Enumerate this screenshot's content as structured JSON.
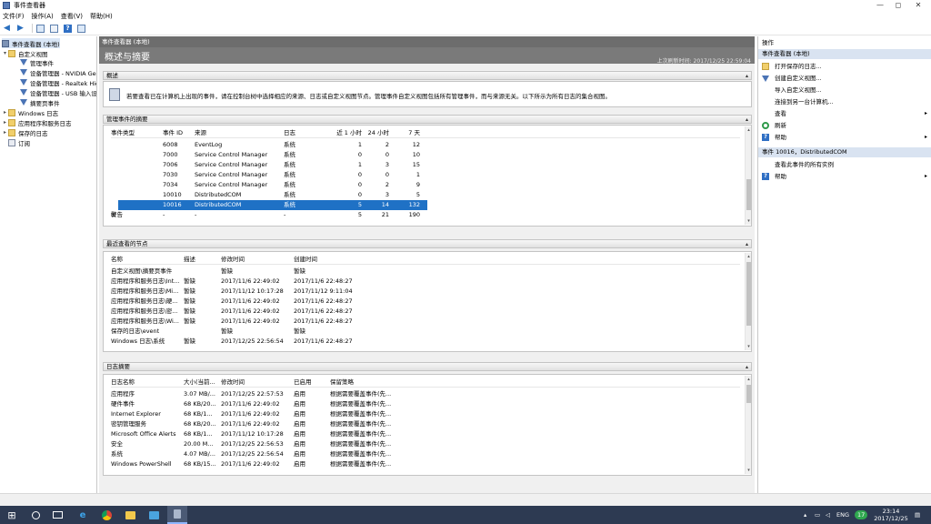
{
  "window": {
    "title": "事件查看器",
    "controls": {
      "minimize": "—",
      "maximize": "◻",
      "close": "✕"
    }
  },
  "menu": [
    "文件(F)",
    "操作(A)",
    "查看(V)",
    "帮助(H)"
  ],
  "tree": {
    "root": "事件查看器 (本地)",
    "items": [
      {
        "label": "自定义视图",
        "level": 1,
        "icon": "folder-icon",
        "expanded": true
      },
      {
        "label": "管理事件",
        "level": 2,
        "icon": "filter-icon"
      },
      {
        "label": "设备管理器 - NVIDIA GeForce",
        "level": 2,
        "icon": "filter-icon"
      },
      {
        "label": "设备管理器 - Realtek High",
        "level": 2,
        "icon": "filter-icon"
      },
      {
        "label": "设备管理器 - USB 输入设备",
        "level": 2,
        "icon": "filter-icon"
      },
      {
        "label": "摘要页事件",
        "level": 2,
        "icon": "filter-icon"
      },
      {
        "label": "Windows 日志",
        "level": 1,
        "icon": "folder-icon"
      },
      {
        "label": "应用程序和服务日志",
        "level": 1,
        "icon": "folder-icon"
      },
      {
        "label": "保存的日志",
        "level": 1,
        "icon": "folder-icon"
      },
      {
        "label": "订阅",
        "level": 1,
        "icon": "log-icon"
      }
    ]
  },
  "center": {
    "header": "事件查看器 (本地)",
    "title": "概述与摘要",
    "last_refresh": "上次刷新时间: 2017/12/25 22:59:04",
    "overview": {
      "label": "概述",
      "text": "若要查看已在计算机上出现的事件，请在控制台树中选择相应的来源、日志或自定义视图节点。管理事件自定义视图包括所有管理事件，而与来源无关。以下所示为所有日志的集合视图。"
    },
    "managed_events": {
      "label": "管理事件的摘要",
      "columns": [
        "事件类型",
        "事件 ID",
        "来源",
        "日志",
        "近 1 小时",
        "24 小时",
        "7 天"
      ],
      "rows": [
        [
          "",
          "6008",
          "EventLog",
          "系统",
          "1",
          "2",
          "12"
        ],
        [
          "",
          "7000",
          "Service Control Manager",
          "系统",
          "0",
          "0",
          "10"
        ],
        [
          "",
          "7006",
          "Service Control Manager",
          "系统",
          "1",
          "3",
          "15"
        ],
        [
          "",
          "7030",
          "Service Control Manager",
          "系统",
          "0",
          "0",
          "1"
        ],
        [
          "",
          "7034",
          "Service Control Manager",
          "系统",
          "0",
          "2",
          "9"
        ],
        [
          "",
          "10010",
          "DistributedCOM",
          "系统",
          "0",
          "3",
          "5"
        ],
        [
          "",
          "10016",
          "DistributedCOM",
          "系统",
          "5",
          "14",
          "132"
        ],
        [
          "警告",
          "-",
          "-",
          "-",
          "5",
          "21",
          "190"
        ]
      ],
      "selected_row": 6
    },
    "recent_nodes": {
      "label": "最近查看的节点",
      "columns": [
        "名称",
        "描述",
        "修改时间",
        "创建时间"
      ],
      "rows": [
        [
          "自定义视图\\摘要页事件",
          "",
          "暂缺",
          "暂缺"
        ],
        [
          "应用程序和服务日志\\Int...",
          "暂缺",
          "2017/11/6 22:49:02",
          "2017/11/6 22:48:27"
        ],
        [
          "应用程序和服务日志\\Mi...",
          "暂缺",
          "2017/11/12 10:17:28",
          "2017/11/12 9:11:04"
        ],
        [
          "应用程序和服务日志\\硬...",
          "暂缺",
          "2017/11/6 22:49:02",
          "2017/11/6 22:48:27"
        ],
        [
          "应用程序和服务日志\\密...",
          "暂缺",
          "2017/11/6 22:49:02",
          "2017/11/6 22:48:27"
        ],
        [
          "应用程序和服务日志\\Wi...",
          "暂缺",
          "2017/11/6 22:49:02",
          "2017/11/6 22:48:27"
        ],
        [
          "保存的日志\\event",
          "",
          "暂缺",
          "暂缺"
        ],
        [
          "Windows 日志\\系统",
          "暂缺",
          "2017/12/25 22:56:54",
          "2017/11/6 22:48:27"
        ]
      ]
    },
    "log_summary": {
      "label": "日志摘要",
      "columns": [
        "日志名称",
        "大小(当前...",
        "修改时间",
        "已启用",
        "保留策略"
      ],
      "rows": [
        [
          "应用程序",
          "3.07 MB/...",
          "2017/12/25 22:57:53",
          "启用",
          "根据需要覆盖事件(先..."
        ],
        [
          "硬件事件",
          "68 KB/20...",
          "2017/11/6 22:49:02",
          "启用",
          "根据需要覆盖事件(先..."
        ],
        [
          "Internet Explorer",
          "68 KB/1...",
          "2017/11/6 22:49:02",
          "启用",
          "根据需要覆盖事件(先..."
        ],
        [
          "密钥管理服务",
          "68 KB/20...",
          "2017/11/6 22:49:02",
          "启用",
          "根据需要覆盖事件(先..."
        ],
        [
          "Microsoft Office Alerts",
          "68 KB/1...",
          "2017/11/12 10:17:28",
          "启用",
          "根据需要覆盖事件(先..."
        ],
        [
          "安全",
          "20.00 M...",
          "2017/12/25 22:56:53",
          "启用",
          "根据需要覆盖事件(先..."
        ],
        [
          "系统",
          "4.07 MB/...",
          "2017/12/25 22:56:54",
          "启用",
          "根据需要覆盖事件(先..."
        ],
        [
          "Windows PowerShell",
          "68 KB/15...",
          "2017/11/6 22:49:02",
          "启用",
          "根据需要覆盖事件(先..."
        ]
      ]
    }
  },
  "actions": {
    "title": "操作",
    "group1": "事件查看器 (本地)",
    "items1": [
      {
        "label": "打开保存的日志...",
        "icon": "folder-icon"
      },
      {
        "label": "创建自定义视图...",
        "icon": "filter-icon"
      },
      {
        "label": "导入自定义视图...",
        "icon": "blank"
      },
      {
        "label": "连接到另一台计算机...",
        "icon": "blank"
      },
      {
        "label": "查看",
        "icon": "blank",
        "submenu": true
      },
      {
        "label": "刷新",
        "icon": "refresh-icon"
      },
      {
        "label": "帮助",
        "icon": "help-icon",
        "submenu": true
      }
    ],
    "group2": "事件 10016，DistributedCOM",
    "items2": [
      {
        "label": "查看此事件的所有实例",
        "icon": "blank"
      },
      {
        "label": "帮助",
        "icon": "help-icon",
        "submenu": true
      }
    ]
  },
  "taskbar": {
    "lang": "ENG",
    "badge": "17",
    "time": "23:14",
    "date": "2017/12/25"
  },
  "glyphs": {
    "expand": "▸",
    "collapse": "▾",
    "plus": "⊞",
    "caret_up": "▴",
    "caret_down": "▾",
    "submenu": "▸"
  }
}
